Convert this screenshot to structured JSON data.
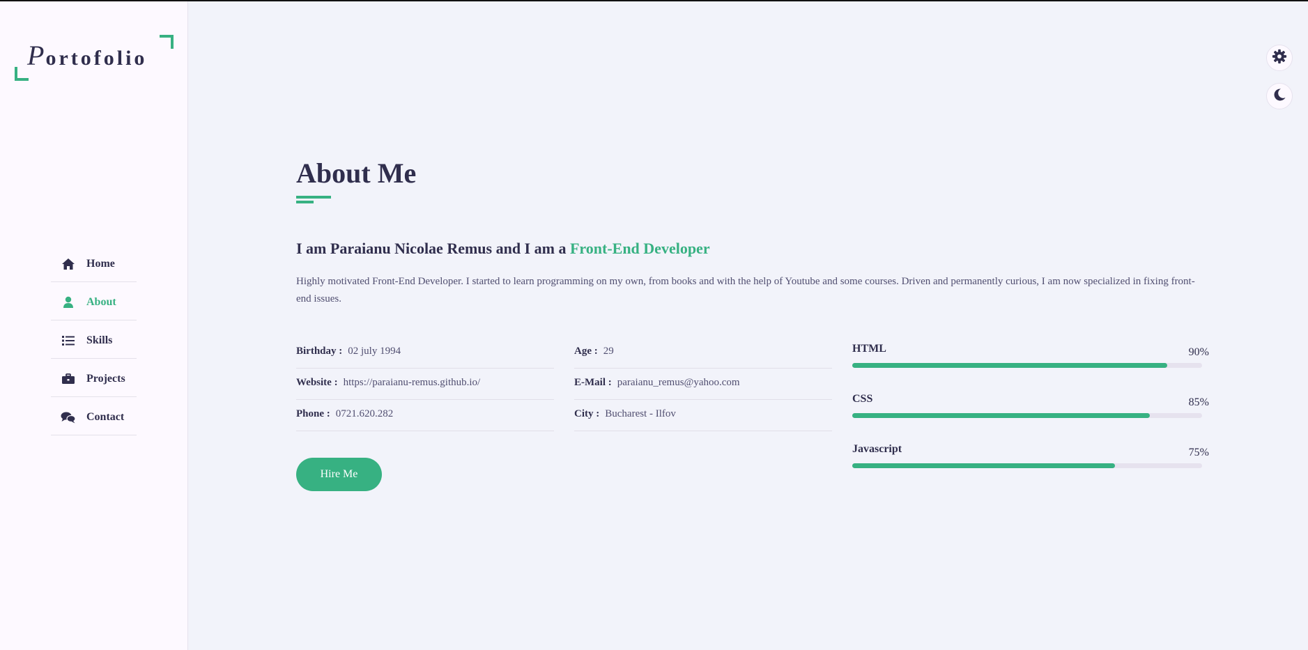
{
  "logo": {
    "first_letter": "P",
    "rest": "ortofolio"
  },
  "nav": [
    {
      "label": "Home",
      "icon": "home-icon"
    },
    {
      "label": "About",
      "icon": "user-icon",
      "active": true
    },
    {
      "label": "Skills",
      "icon": "list-icon"
    },
    {
      "label": "Projects",
      "icon": "briefcase-icon"
    },
    {
      "label": "Contact",
      "icon": "comments-icon"
    }
  ],
  "switcher": {
    "settings_icon": "gear-icon",
    "theme_icon": "moon-icon"
  },
  "about": {
    "title": "About Me",
    "intro_prefix": "I am Paraianu Nicolae Remus and I am a ",
    "intro_accent": "Front-End Developer",
    "description": "Highly motivated Front-End Developer. I started to learn programming on my own, from books and with the help of Youtube and some courses. Driven and permanently curious, I am now specialized in fixing front-end issues.",
    "info_col1": [
      {
        "label": "Birthday :",
        "value": "02 july 1994"
      },
      {
        "label": "Website :",
        "value": "https://paraianu-remus.github.io/"
      },
      {
        "label": "Phone :",
        "value": "0721.620.282"
      }
    ],
    "info_col2": [
      {
        "label": "Age :",
        "value": "29"
      },
      {
        "label": "E-Mail :",
        "value": "paraianu_remus@yahoo.com"
      },
      {
        "label": "City :",
        "value": "Bucharest - Ilfov"
      }
    ],
    "hire_label": "Hire Me",
    "skills": [
      {
        "name": "HTML",
        "percent_label": "90%",
        "level": 0.9
      },
      {
        "name": "CSS",
        "percent_label": "85%",
        "level": 0.85
      },
      {
        "name": "Javascript",
        "percent_label": "75%",
        "level": 0.75
      }
    ]
  },
  "colors": {
    "accent": "#37b182",
    "text": "#302e4d",
    "background": "#f2f3fa",
    "sidebar": "#fdf9ff"
  }
}
